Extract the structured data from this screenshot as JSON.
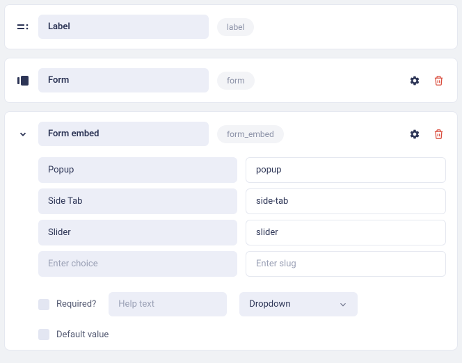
{
  "fields": [
    {
      "label": "Label",
      "slug": "label"
    },
    {
      "label": "Form",
      "slug": "form"
    },
    {
      "label": "Form embed",
      "slug": "form_embed"
    }
  ],
  "choices": [
    {
      "label": "Popup",
      "slug": "popup"
    },
    {
      "label": "Side Tab",
      "slug": "side-tab"
    },
    {
      "label": "Slider",
      "slug": "slider"
    }
  ],
  "choice_placeholder": {
    "label": "Enter choice",
    "slug": "Enter slug"
  },
  "options": {
    "required_label": "Required?",
    "help_placeholder": "Help text",
    "type_selected": "Dropdown",
    "default_label": "Default value"
  }
}
